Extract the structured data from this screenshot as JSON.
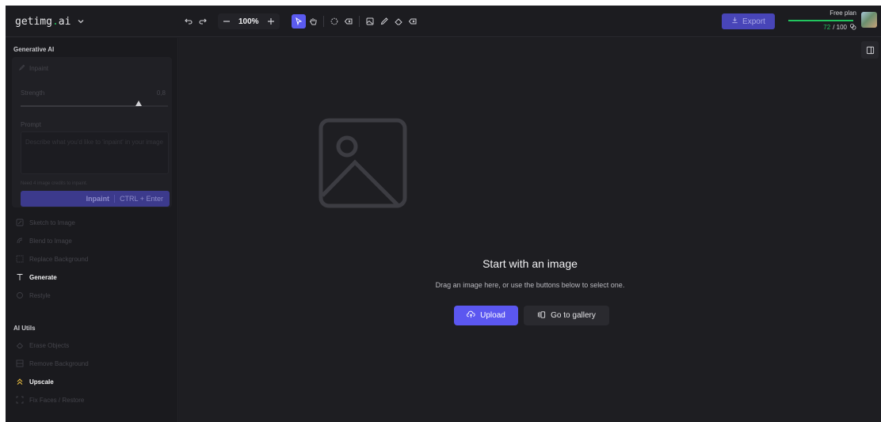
{
  "header": {
    "brand_name": "getimg",
    "brand_dot": ".",
    "brand_ext": "ai",
    "zoom": "100%",
    "export_label": "Export",
    "plan": {
      "title": "Free plan",
      "used": "72",
      "total": "/ 100",
      "fraction": 0.72
    }
  },
  "sidebar": {
    "generative_title": "Generative AI",
    "inpaint_panel": {
      "title": "Inpaint",
      "strength_label": "Strength",
      "strength_value": "0,8",
      "prompt_label": "Prompt",
      "prompt_placeholder": "Describe what you'd like to 'inpaint' in your image",
      "credit_note": "Need 4 image credits to inpaint.",
      "button_label": "Inpaint",
      "button_shortcut": "CTRL + Enter"
    },
    "generative_items": [
      {
        "label": "Sketch to Image",
        "state": "disabled",
        "icon": "sketch-icon"
      },
      {
        "label": "Blend to Image",
        "state": "disabled",
        "icon": "blend-icon"
      },
      {
        "label": "Replace Background",
        "state": "disabled",
        "icon": "replace-bg-icon"
      },
      {
        "label": "Generate",
        "state": "active",
        "icon": "text-t-icon"
      },
      {
        "label": "Restyle",
        "state": "disabled",
        "icon": "restyle-icon"
      }
    ],
    "utils_title": "AI Utils",
    "utils_items": [
      {
        "label": "Erase Objects",
        "state": "disabled",
        "icon": "eraser-icon"
      },
      {
        "label": "Remove Background",
        "state": "disabled",
        "icon": "remove-bg-icon"
      },
      {
        "label": "Upscale",
        "state": "active",
        "icon": "upscale-icon"
      },
      {
        "label": "Fix Faces / Restore",
        "state": "disabled",
        "icon": "face-icon"
      }
    ]
  },
  "canvas": {
    "empty_title": "Start with an image",
    "empty_subtitle": "Drag an image here, or use the buttons below to select one.",
    "upload_label": "Upload",
    "gallery_label": "Go to gallery"
  },
  "colors": {
    "accent": "#5b57f0",
    "credit_green": "#22c55e",
    "upscale_icon": "#f5c542"
  }
}
